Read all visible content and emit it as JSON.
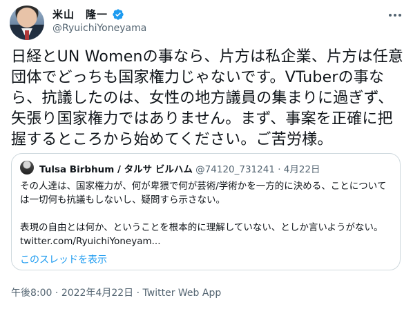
{
  "author": {
    "name": "米山　隆一",
    "handle": "@RyuichiYoneyama"
  },
  "tweet": {
    "text": "日経とUN Womenの事なら、片方は私企業、片方は任意団体でどっちも国家権力じゃないです。VTuberの事なら、抗議したのは、女性の地方議員の集まりに過ぎず、矢張り国家権力ではありません。まず、事案を正確に把握するところから始めてください。ご苦労様。",
    "time": "午後8:00",
    "dot1": " · ",
    "date": "2022年4月22日",
    "dot2": " · ",
    "source": "Twitter Web App"
  },
  "quoted": {
    "name": "Tulsa Birbhum / タルサ ビルハム",
    "handle": "@74120_731241",
    "dot": " · ",
    "date": "4月22日",
    "text": "その人達は、国家権力が、何が卑猥で何が芸術/学術かを一方的に決める、ことについては一切何も抗議もしないし、疑問すら示さない。\n\n表現の自由とは何か、ということを根本的に理解していない、としか言いようがない。 ",
    "link": "twitter.com/RyuichiYoneyam...",
    "thread_label": "このスレッドを表示"
  },
  "colors": {
    "accent": "#1d9bf0",
    "text": "#0f1419",
    "muted": "#536471",
    "border": "#cfd9de"
  },
  "icons": {
    "verified": "verified-badge-icon",
    "more": "more-options-icon"
  }
}
